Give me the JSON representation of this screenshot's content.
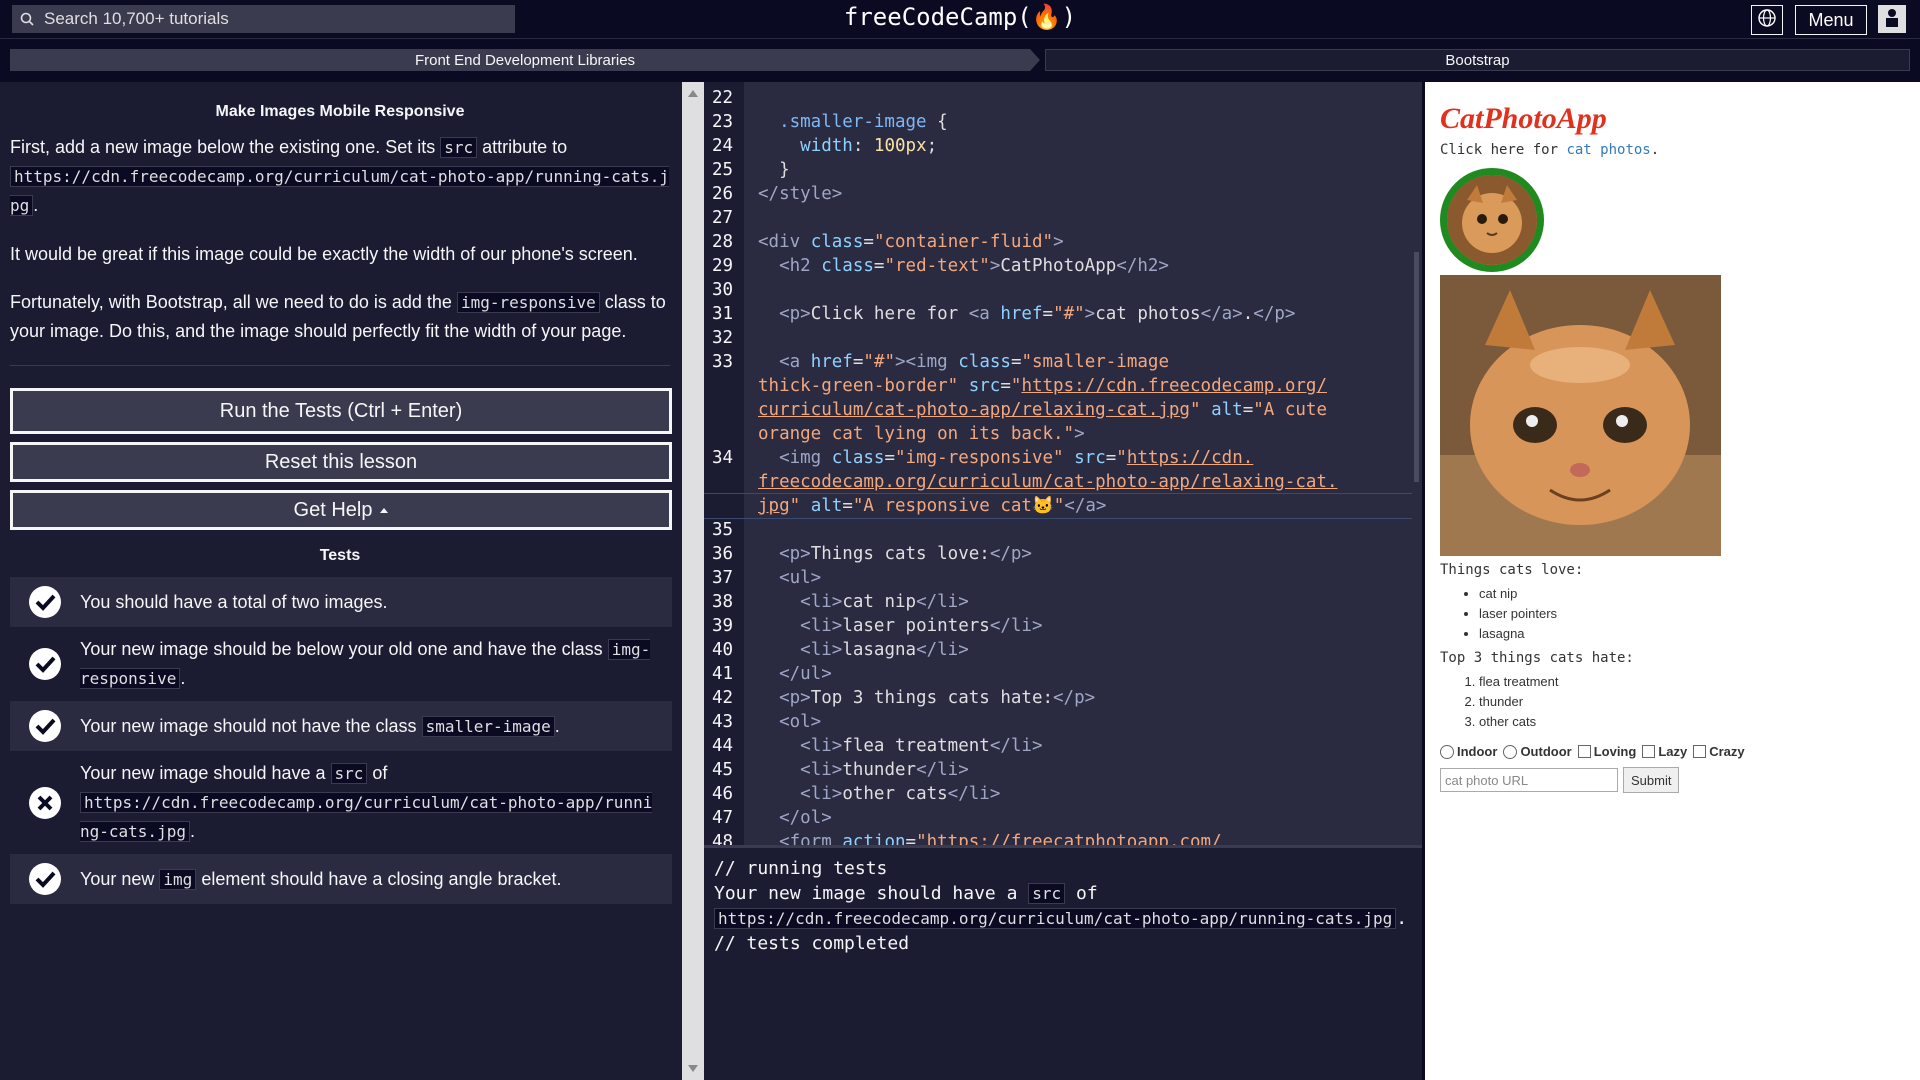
{
  "nav": {
    "search_placeholder": "Search 10,700+ tutorials",
    "logo": "freeCodeCamp(🔥)",
    "menu_label": "Menu"
  },
  "breadcrumb": {
    "superblock": "Front End Development Libraries",
    "block": "Bootstrap"
  },
  "lesson": {
    "title": "Make Images Mobile Responsive",
    "p1_a": "First, add a new image below the existing one. Set its ",
    "p1_code1": "src",
    "p1_b": " attribute to",
    "p1_code2": "https://cdn.freecodecamp.org/curriculum/cat-photo-app/running-cats.jpg",
    "p1_c": ".",
    "p2": "It would be great if this image could be exactly the width of our phone's screen.",
    "p3_a": "Fortunately, with Bootstrap, all we need to do is add the ",
    "p3_code": "img-responsive",
    "p3_b": " class to your image. Do this, and the image should perfectly fit the width of your page."
  },
  "buttons": {
    "run": "Run the Tests (Ctrl + Enter)",
    "reset": "Reset this lesson",
    "help": "Get Help"
  },
  "tests_title": "Tests",
  "tests": [
    {
      "status": "pass",
      "a": "You should have a total of two images.",
      "code": "",
      "b": ""
    },
    {
      "status": "pass",
      "a": "Your new image should be below your old one and have the class ",
      "code": "img-responsive",
      "b": "."
    },
    {
      "status": "pass",
      "a": "Your new image should not have the class ",
      "code": "smaller-image",
      "b": "."
    },
    {
      "status": "fail",
      "a": "Your new image should have a ",
      "code": "src",
      "b": " of ",
      "code2": "https://cdn.freecodecamp.org/curriculum/cat-photo-app/running-cats.jpg",
      "c": "."
    },
    {
      "status": "pass",
      "a": "Your new ",
      "code": "img",
      "b": " element should have a closing angle bracket."
    }
  ],
  "editor": {
    "line_numbers": [
      "22",
      "23",
      "24",
      "25",
      "26",
      "27",
      "28",
      "29",
      "30",
      "31",
      "32",
      "33",
      "",
      "",
      "",
      "34",
      "",
      "",
      "35",
      "36",
      "37",
      "38",
      "39",
      "40",
      "41",
      "42",
      "43",
      "44",
      "45",
      "46",
      "47",
      "48"
    ]
  },
  "console": {
    "l1": "// running tests",
    "l2_a": "Your new image should have a ",
    "l2_code": "src",
    "l2_b": " of",
    "l3_code": "https://cdn.freecodecamp.org/curriculum/cat-photo-app/running-cats.jpg",
    "l3_b": ".",
    "l4": "// tests completed"
  },
  "preview": {
    "title": "CatPhotoApp",
    "click_a": "Click here for ",
    "click_link": "cat photos",
    "click_b": ".",
    "love_title": "Things cats love:",
    "love": [
      "cat nip",
      "laser pointers",
      "lasagna"
    ],
    "hate_title": "Top 3 things cats hate:",
    "hate": [
      "flea treatment",
      "thunder",
      "other cats"
    ],
    "radios": [
      "Indoor",
      "Outdoor"
    ],
    "checks": [
      "Loving",
      "Lazy",
      "Crazy"
    ],
    "url_placeholder": "cat photo URL",
    "submit": "Submit"
  },
  "colors": {
    "bg_dark": "#0a0a23",
    "panel": "#1b1b32",
    "editor_bg": "#2a2a40",
    "preview_title": "#e0301e",
    "green_border": "#1f8a1f"
  }
}
